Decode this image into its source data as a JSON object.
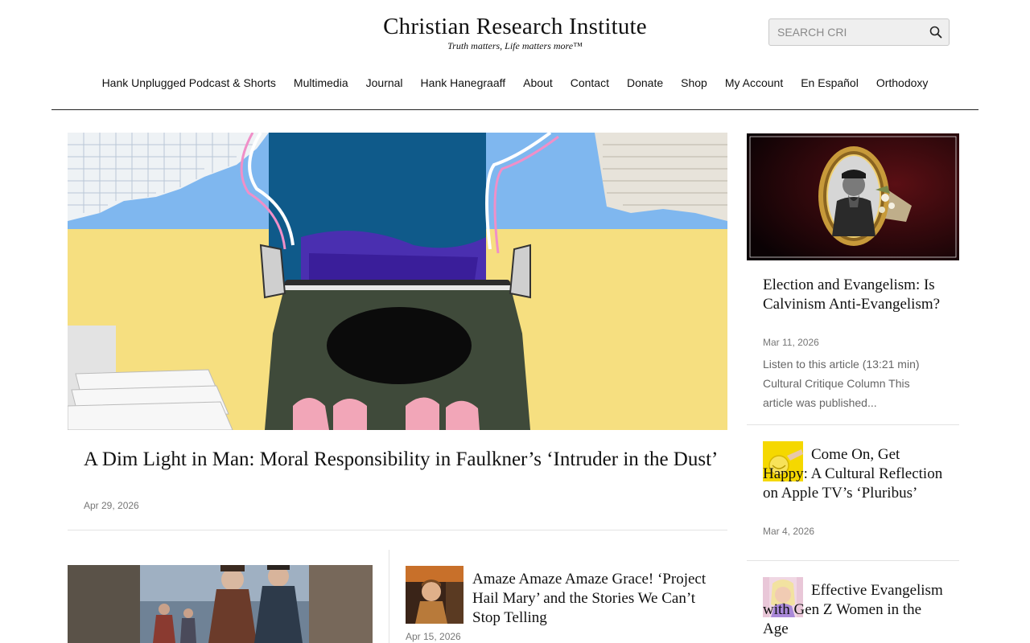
{
  "header": {
    "site_title": "Christian Research Institute",
    "tagline": "Truth matters, Life matters more™",
    "search_placeholder": "SEARCH CRI"
  },
  "nav": {
    "items": [
      {
        "label": "Hank Unplugged Podcast & Shorts"
      },
      {
        "label": "Multimedia"
      },
      {
        "label": "Journal"
      },
      {
        "label": "Hank Hanegraaff"
      },
      {
        "label": "About"
      },
      {
        "label": "Contact"
      },
      {
        "label": "Donate"
      },
      {
        "label": "Shop"
      },
      {
        "label": "My Account"
      },
      {
        "label": "En Español"
      },
      {
        "label": "Orthodoxy"
      }
    ]
  },
  "featured": {
    "title": "A Dim Light in Man: Moral Responsibility in Faulkner’s ‘Intruder in the Dust’",
    "date": "Apr 29, 2026"
  },
  "articles": [
    {
      "title": "Amaze Amaze Amaze Grace! ‘Project Hail Mary’ and the Stories We Can’t Stop Telling",
      "date": "Apr 15, 2026"
    }
  ],
  "sidebar": {
    "items": [
      {
        "title": "Election and Evangelism: Is Calvinism Anti-Evangelism?",
        "date": "Mar 11, 2026",
        "excerpt": "Listen to this article (13:21 min) Cultural Critique Column   This article was published..."
      },
      {
        "title": "Come On, Get Happy: A Cultural Reflection on Apple TV’s ‘Pluribus’",
        "date": "Mar 4, 2026"
      },
      {
        "title": "Effective Evangelism with Gen Z Women in the Age"
      }
    ]
  },
  "colors": {
    "text": "#111111",
    "muted": "#777777",
    "rule": "#e3e3e3"
  }
}
